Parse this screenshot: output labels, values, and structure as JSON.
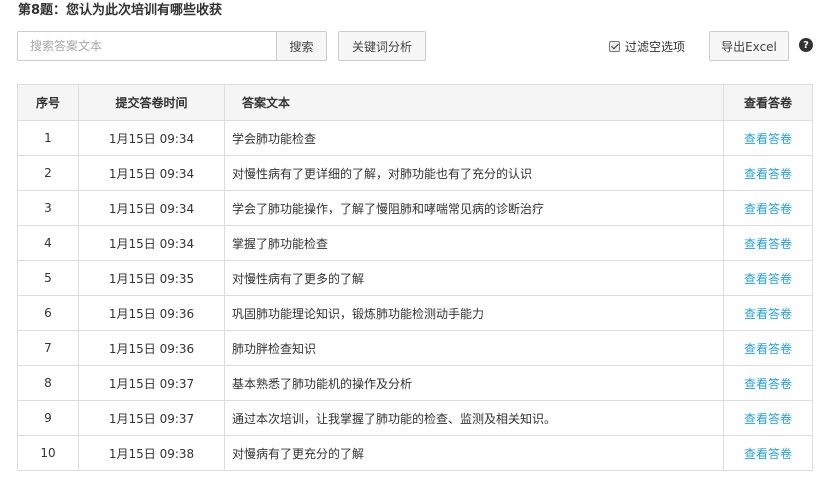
{
  "question_title": "第8题：您认为此次培训有哪些收获",
  "toolbar": {
    "search_placeholder": "搜索答案文本",
    "search_button": "搜索",
    "keyword_button": "关键词分析",
    "filter_label": "过滤空选项",
    "filter_checked": true,
    "export_button": "导出Excel",
    "help_symbol": "?"
  },
  "table": {
    "headers": {
      "num": "序号",
      "time": "提交答卷时间",
      "answer": "答案文本",
      "view": "查看答卷"
    },
    "rows": [
      {
        "num": "1",
        "time": "1月15日 09:34",
        "answer": "学会肺功能检查",
        "view": "查看答卷"
      },
      {
        "num": "2",
        "time": "1月15日 09:34",
        "answer": "对慢性病有了更详细的了解，对肺功能也有了充分的认识",
        "view": "查看答卷"
      },
      {
        "num": "3",
        "time": "1月15日 09:34",
        "answer": "学会了肺功能操作，了解了慢阻肺和哮喘常见病的诊断治疗",
        "view": "查看答卷"
      },
      {
        "num": "4",
        "time": "1月15日 09:34",
        "answer": "掌握了肺功能检查",
        "view": "查看答卷"
      },
      {
        "num": "5",
        "time": "1月15日 09:35",
        "answer": "对慢性病有了更多的了解",
        "view": "查看答卷"
      },
      {
        "num": "6",
        "time": "1月15日 09:36",
        "answer": "巩固肺功能理论知识，锻炼肺功能检测动手能力",
        "view": "查看答卷"
      },
      {
        "num": "7",
        "time": "1月15日 09:36",
        "answer": "肺功胖检查知识",
        "view": "查看答卷"
      },
      {
        "num": "8",
        "time": "1月15日 09:37",
        "answer": "基本熟悉了肺功能机的操作及分析",
        "view": "查看答卷"
      },
      {
        "num": "9",
        "time": "1月15日 09:37",
        "answer": "通过本次培训，让我掌握了肺功能的检查、监测及相关知识。",
        "view": "查看答卷"
      },
      {
        "num": "10",
        "time": "1月15日 09:38",
        "answer": "对慢病有了更充分的了解",
        "view": "查看答卷"
      }
    ]
  }
}
